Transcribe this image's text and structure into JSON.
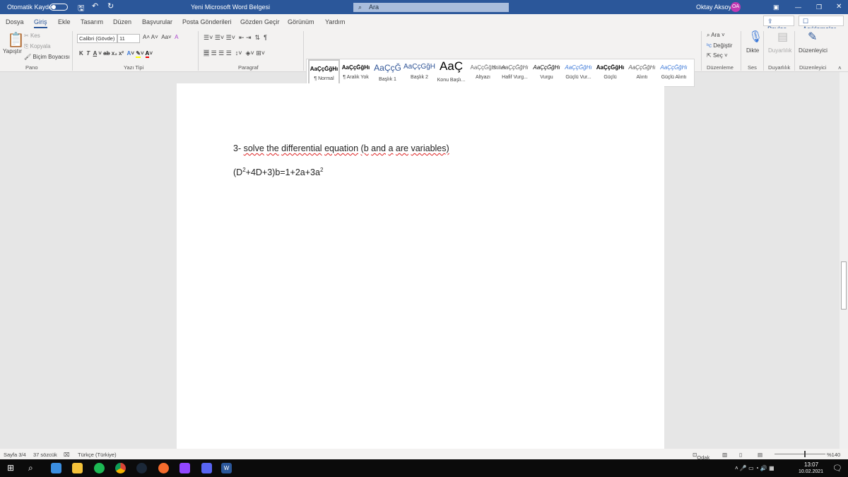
{
  "titlebar": {
    "autosave": "Otomatik Kaydet",
    "doc_title": "Yeni Microsoft Word Belgesi",
    "search_placeholder": "Ara",
    "user": "Oktay Aksoy",
    "initials": "OA",
    "accent": "#2b579a"
  },
  "tabs": [
    "Dosya",
    "Giriş",
    "Ekle",
    "Tasarım",
    "Düzen",
    "Başvurular",
    "Posta Gönderileri",
    "Gözden Geçir",
    "Görünüm",
    "Yardım"
  ],
  "active_tab": "Giriş",
  "share": "Paylaş",
  "comments": "Açıklamalar",
  "ribbon": {
    "clipboard": {
      "paste": "Yapıştır",
      "cut": "Kes",
      "copy": "Kopyala",
      "format_painter": "Biçim Boyacısı",
      "label": "Pano"
    },
    "font": {
      "name": "Calibri (Gövde)",
      "size": "11",
      "label": "Yazı Tipi"
    },
    "paragraph": {
      "label": "Paragraf"
    },
    "styles": {
      "label": "Stiller",
      "items": [
        {
          "preview": "AaÇçĞğHı",
          "name": "¶ Normal"
        },
        {
          "preview": "AaÇçĞğHı",
          "name": "¶ Aralık Yok"
        },
        {
          "preview": "AaÇçĞ",
          "name": "Başlık 1"
        },
        {
          "preview": "AaÇçĞğH",
          "name": "Başlık 2"
        },
        {
          "preview": "AaÇ",
          "name": "Konu Başlı..."
        },
        {
          "preview": "AaÇçĞğH",
          "name": "Altyazı"
        },
        {
          "preview": "AaÇçĞğHı",
          "name": "Hafif Vurg..."
        },
        {
          "preview": "AaÇçĞğHı",
          "name": "Vurgu"
        },
        {
          "preview": "AaÇçĞğHı",
          "name": "Güçlü Vur..."
        },
        {
          "preview": "AaÇçĞğHı",
          "name": "Güçlü"
        },
        {
          "preview": "AaÇçĞğHı",
          "name": "Alıntı"
        },
        {
          "preview": "AaÇçĞğHı",
          "name": "Güçlü Alıntı"
        }
      ]
    },
    "editing": {
      "find": "Ara",
      "replace": "Değiştir",
      "select": "Seç",
      "label": "Düzenleme"
    },
    "voice": {
      "dictate": "Dikte",
      "label": "Ses"
    },
    "sensitivity": {
      "btn": "Duyarlılık",
      "label": "Duyarlılık"
    },
    "editor": {
      "btn": "Düzenleyici",
      "label": "Düzenleyici"
    }
  },
  "document": {
    "line1_prefix": "3- ",
    "line1_words": [
      "solve",
      "the",
      "differential",
      "equation",
      "(b",
      "and",
      "a",
      "are",
      "variables)"
    ],
    "eq_main": "(D",
    "eq_sup1": "2",
    "eq_mid": "+4D+3)b=1+2a+3a",
    "eq_sup2": "2"
  },
  "status": {
    "page": "Sayfa 3/4",
    "words": "37 sözcük",
    "language": "Türkçe (Türkiye)",
    "focus": "Odak",
    "zoom": "%140",
    "zoom_percent": 140
  },
  "taskbar": {
    "time": "13:07",
    "date": "10.02.2021",
    "mail_badge": "7",
    "notif_badge": "8"
  }
}
